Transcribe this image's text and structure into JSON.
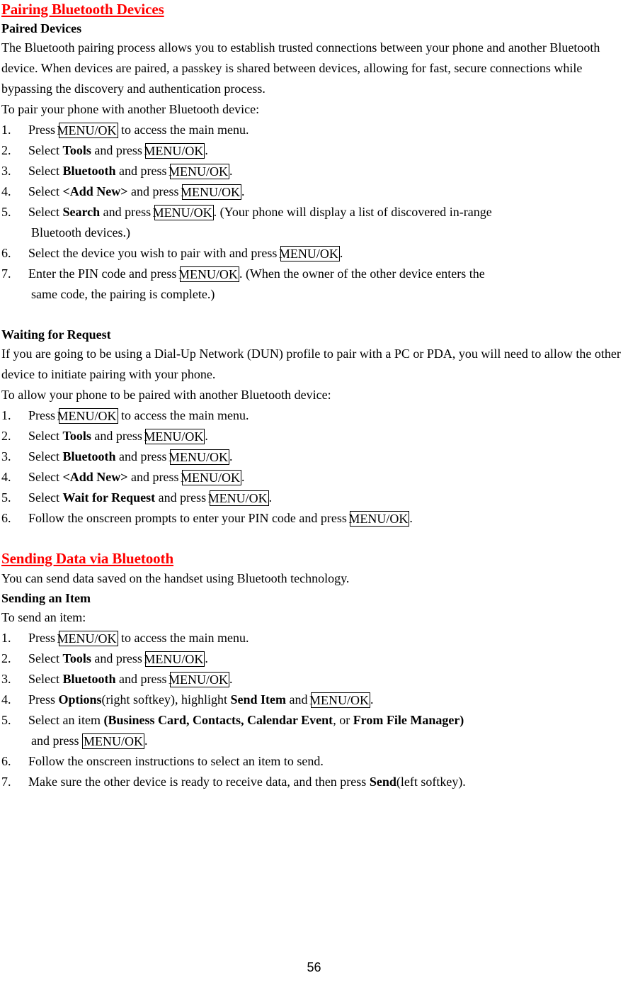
{
  "document": {
    "page_number": "56",
    "accent_color": "#ff0000",
    "key_label": "MENU/OK"
  },
  "sections": [
    {
      "heading": "Pairing Bluetooth Devices",
      "heading_style": "red-underline",
      "subheading": "Paired Devices",
      "intro": "The Bluetooth pairing process allows you to establish trusted connections between your phone and another Bluetooth device. When devices are paired, a passkey is shared between devices, allowing for fast, secure connections while bypassing the discovery and authentication process.",
      "lead_in": "To pair your phone with another Bluetooth device:",
      "steps": [
        {
          "n": "1.",
          "parts": [
            {
              "t": "Press ",
              "s": "n"
            },
            {
              "t": "MENU/OK",
              "s": "key"
            },
            {
              "t": " to access the main menu.",
              "s": "n"
            }
          ]
        },
        {
          "n": "2.",
          "parts": [
            {
              "t": "Select ",
              "s": "n"
            },
            {
              "t": "Tools",
              "s": "b"
            },
            {
              "t": " and press ",
              "s": "n"
            },
            {
              "t": "MENU/OK",
              "s": "key"
            },
            {
              "t": ".",
              "s": "n"
            }
          ]
        },
        {
          "n": "3.",
          "parts": [
            {
              "t": "Select ",
              "s": "n"
            },
            {
              "t": "Bluetooth",
              "s": "b"
            },
            {
              "t": " and press ",
              "s": "n"
            },
            {
              "t": "MENU/OK",
              "s": "key"
            },
            {
              "t": ".",
              "s": "n"
            }
          ]
        },
        {
          "n": "4.",
          "parts": [
            {
              "t": "Select ",
              "s": "n"
            },
            {
              "t": "<Add New>",
              "s": "b"
            },
            {
              "t": " and press ",
              "s": "n"
            },
            {
              "t": "MENU/OK",
              "s": "key"
            },
            {
              "t": ".",
              "s": "n"
            }
          ]
        },
        {
          "n": "5.",
          "parts": [
            {
              "t": "Select ",
              "s": "n"
            },
            {
              "t": "Search",
              "s": "b"
            },
            {
              "t": " and press ",
              "s": "n"
            },
            {
              "t": "MENU/OK",
              "s": "key"
            },
            {
              "t": ". (Your phone will display a list of discovered in-range",
              "s": "n"
            }
          ],
          "cont": "Bluetooth devices.)"
        },
        {
          "n": "6.",
          "parts": [
            {
              "t": "Select the device you wish to pair with and press ",
              "s": "n"
            },
            {
              "t": "MENU/OK",
              "s": "key"
            },
            {
              "t": ".",
              "s": "n"
            }
          ]
        },
        {
          "n": "7.",
          "parts": [
            {
              "t": "Enter the PIN code and press ",
              "s": "n"
            },
            {
              "t": "MENU/OK",
              "s": "key"
            },
            {
              "t": ". (When the owner of the other device enters the",
              "s": "n"
            }
          ],
          "cont": "same code, the pairing is complete.)"
        }
      ]
    },
    {
      "heading": "Waiting for Request",
      "heading_style": "black-bold",
      "intro": "If you are going to be using a Dial-Up Network (DUN) profile to pair with a PC or PDA, you will need to allow the other device to initiate pairing with your phone.",
      "lead_in": "To allow your phone to be paired with another Bluetooth device:",
      "steps": [
        {
          "n": "1.",
          "parts": [
            {
              "t": "Press ",
              "s": "n"
            },
            {
              "t": "MENU/OK",
              "s": "key"
            },
            {
              "t": " to access the main menu.",
              "s": "n"
            }
          ]
        },
        {
          "n": "2.",
          "parts": [
            {
              "t": "Select ",
              "s": "n"
            },
            {
              "t": "Tools",
              "s": "b"
            },
            {
              "t": " and press ",
              "s": "n"
            },
            {
              "t": "MENU/OK",
              "s": "key"
            },
            {
              "t": ".",
              "s": "n"
            }
          ]
        },
        {
          "n": "3.",
          "parts": [
            {
              "t": "Select ",
              "s": "n"
            },
            {
              "t": "Bluetooth",
              "s": "b"
            },
            {
              "t": " and press ",
              "s": "n"
            },
            {
              "t": "MENU/OK",
              "s": "key"
            },
            {
              "t": ".",
              "s": "n"
            }
          ]
        },
        {
          "n": "4.",
          "parts": [
            {
              "t": "Select ",
              "s": "n"
            },
            {
              "t": "<Add New>",
              "s": "b"
            },
            {
              "t": " and press ",
              "s": "n"
            },
            {
              "t": "MENU/OK",
              "s": "key"
            },
            {
              "t": ".",
              "s": "n"
            }
          ]
        },
        {
          "n": "5.",
          "parts": [
            {
              "t": "Select ",
              "s": "n"
            },
            {
              "t": "Wait for Request",
              "s": "b"
            },
            {
              "t": " and press ",
              "s": "n"
            },
            {
              "t": "MENU/OK",
              "s": "key"
            },
            {
              "t": ".",
              "s": "n"
            }
          ]
        },
        {
          "n": "6.",
          "parts": [
            {
              "t": "Follow the onscreen prompts to enter your PIN code and press ",
              "s": "n"
            },
            {
              "t": "MENU/OK",
              "s": "key"
            },
            {
              "t": ".",
              "s": "n"
            }
          ]
        }
      ]
    },
    {
      "heading": "Sending Data via Bluetooth",
      "heading_style": "red-underline",
      "intro": "You can send data saved on the handset using Bluetooth technology.",
      "subheading": "Sending an Item",
      "lead_in": "To send an item:",
      "steps": [
        {
          "n": "1.",
          "parts": [
            {
              "t": "Press ",
              "s": "n"
            },
            {
              "t": "MENU/OK",
              "s": "key"
            },
            {
              "t": " to access the main menu.",
              "s": "n"
            }
          ]
        },
        {
          "n": "2.",
          "parts": [
            {
              "t": "Select ",
              "s": "n"
            },
            {
              "t": "Tools",
              "s": "b"
            },
            {
              "t": " and press ",
              "s": "n"
            },
            {
              "t": "MENU/OK",
              "s": "key"
            },
            {
              "t": ".",
              "s": "n"
            }
          ]
        },
        {
          "n": "3.",
          "parts": [
            {
              "t": "Select ",
              "s": "n"
            },
            {
              "t": "Bluetooth",
              "s": "b"
            },
            {
              "t": " and press ",
              "s": "n"
            },
            {
              "t": "MENU/OK",
              "s": "key"
            },
            {
              "t": ".",
              "s": "n"
            }
          ]
        },
        {
          "n": "4.",
          "parts": [
            {
              "t": "Press ",
              "s": "n"
            },
            {
              "t": "Options",
              "s": "b"
            },
            {
              "t": "(right softkey), highlight ",
              "s": "n"
            },
            {
              "t": "Send Item",
              "s": "b"
            },
            {
              "t": " and ",
              "s": "n"
            },
            {
              "t": "MENU/OK",
              "s": "key"
            },
            {
              "t": ".",
              "s": "n"
            }
          ]
        },
        {
          "n": "5.",
          "parts": [
            {
              "t": "Select an item ",
              "s": "n"
            },
            {
              "t": "(Business Card",
              "s": "b"
            },
            {
              "t": ", ",
              "s": "b"
            },
            {
              "t": "Contacts",
              "s": "b"
            },
            {
              "t": ", ",
              "s": "b"
            },
            {
              "t": "Calendar Event",
              "s": "b"
            },
            {
              "t": ", ",
              "s": "n"
            },
            {
              "t": "or ",
              "s": "n"
            },
            {
              "t": "From File Manager)",
              "s": "b"
            }
          ],
          "cont_parts": [
            {
              "t": "and press ",
              "s": "n"
            },
            {
              "t": "MENU/OK",
              "s": "key"
            },
            {
              "t": ".",
              "s": "n"
            }
          ]
        },
        {
          "n": "6.",
          "parts": [
            {
              "t": "Follow the onscreen instructions to select an item to send.",
              "s": "n"
            }
          ]
        },
        {
          "n": "7.",
          "parts": [
            {
              "t": "Make sure the other device is ready to receive data, and then press ",
              "s": "n"
            },
            {
              "t": "Send",
              "s": "b"
            },
            {
              "t": "(left softkey).",
              "s": "n"
            }
          ]
        }
      ]
    }
  ]
}
